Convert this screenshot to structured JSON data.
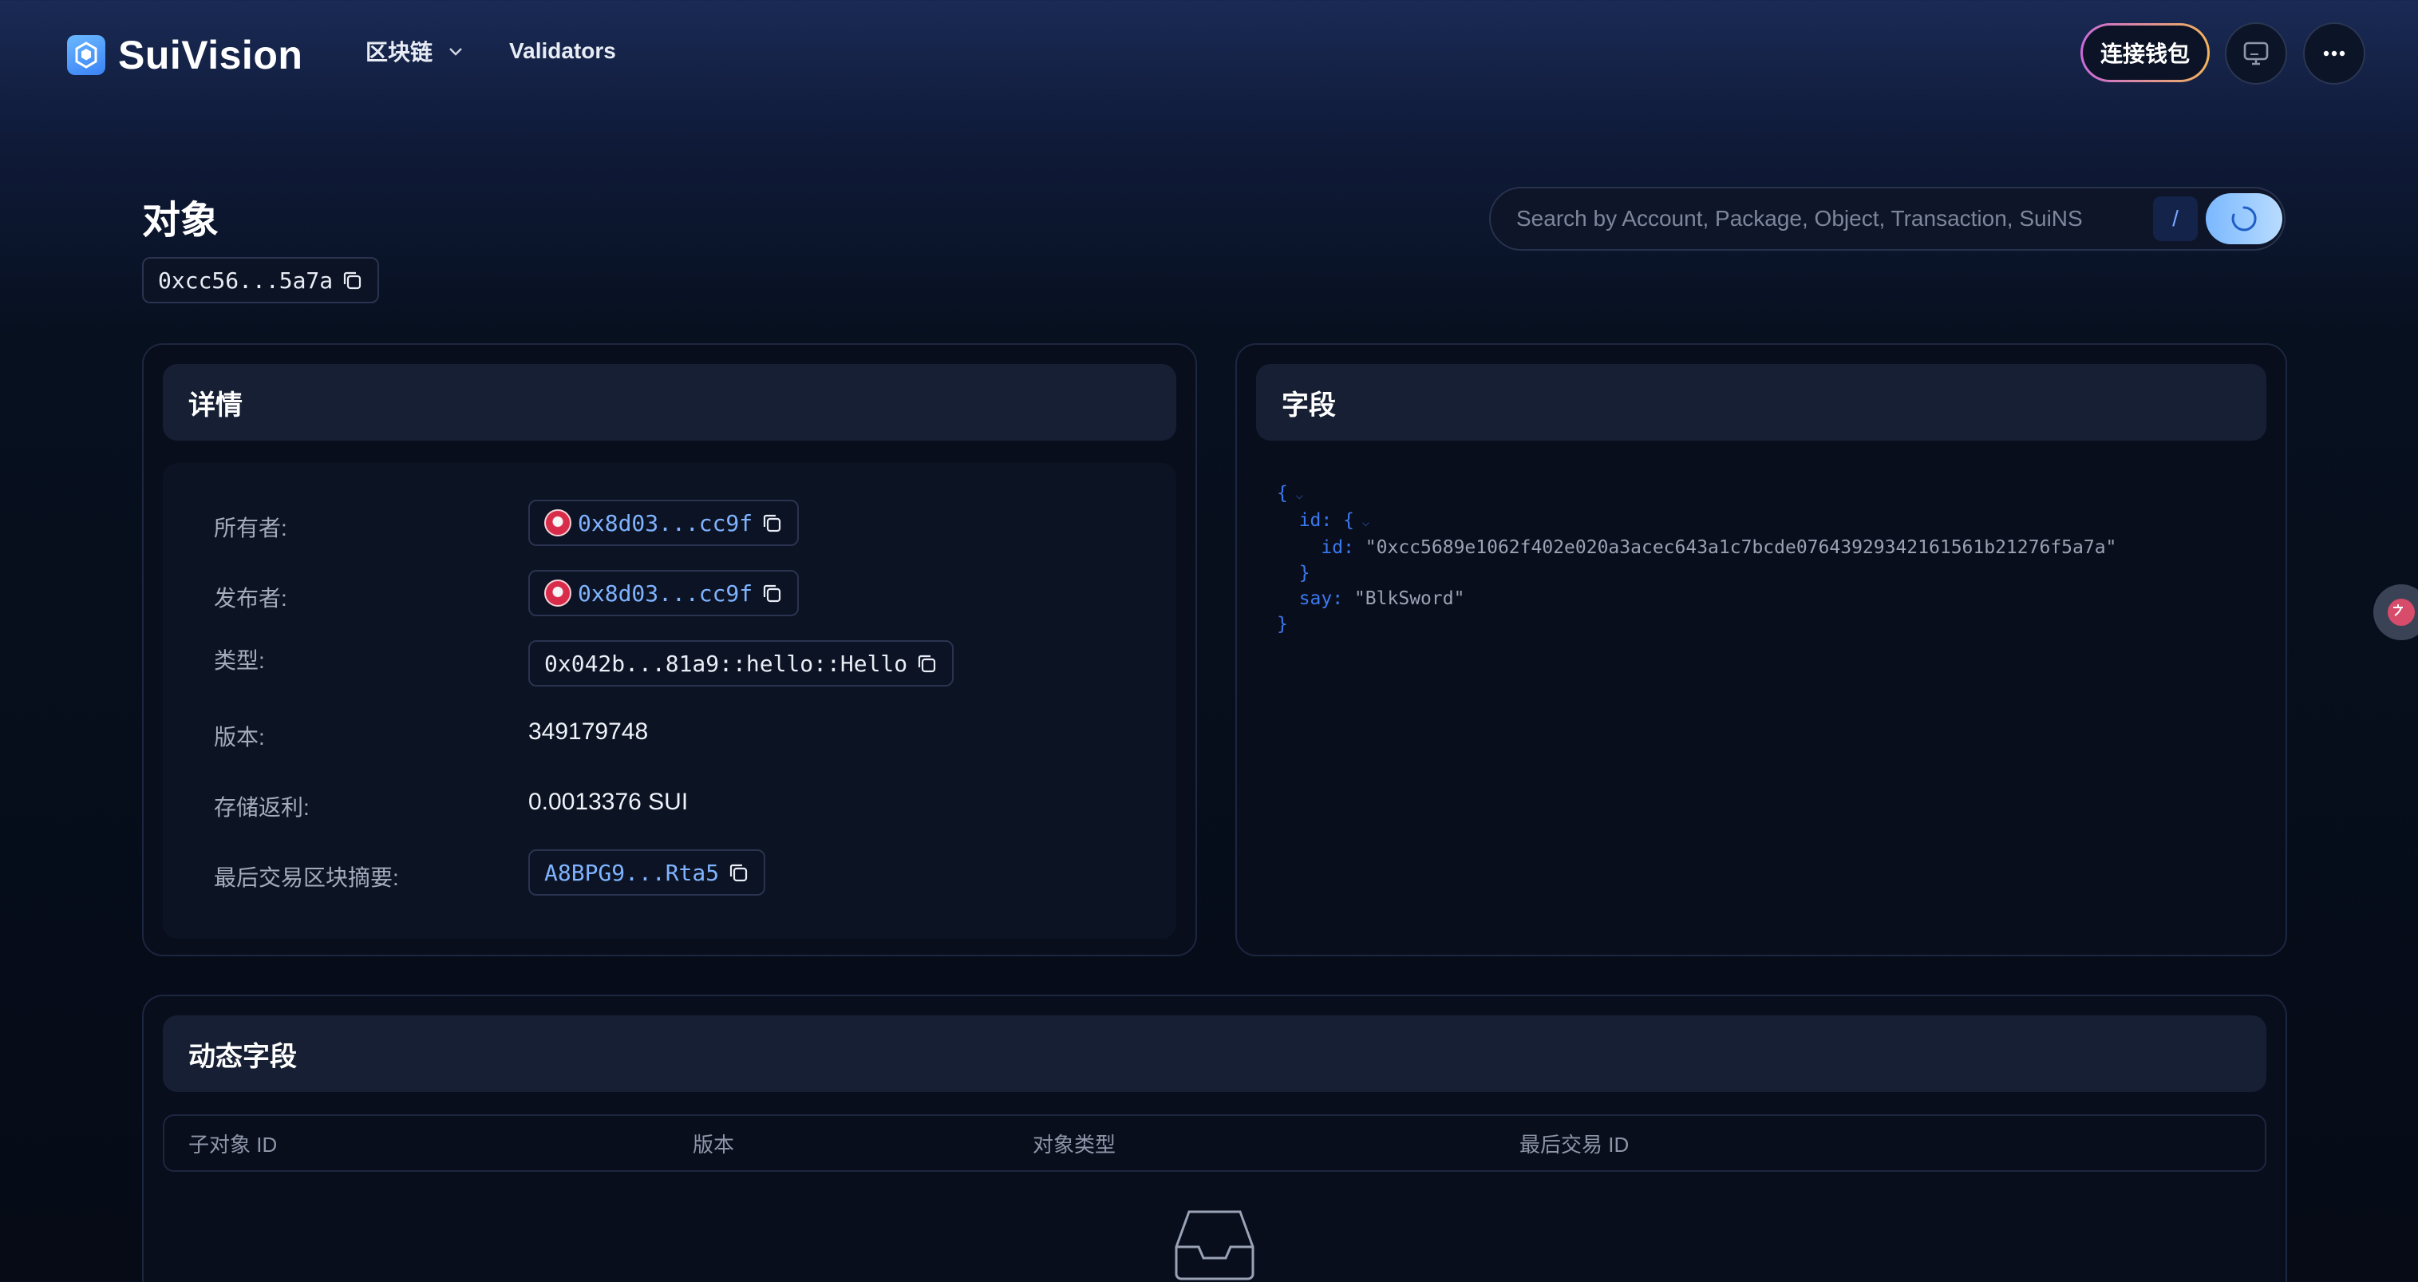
{
  "header": {
    "brand": "SuiVision",
    "nav": [
      {
        "label": "区块链",
        "has_dropdown": true
      },
      {
        "label": "Validators",
        "has_dropdown": false
      }
    ],
    "connect_wallet": "连接钱包",
    "icons": [
      "monitor-icon",
      "more-icon"
    ]
  },
  "page": {
    "title": "对象",
    "object_short_id": "0xcc56...5a7a"
  },
  "search": {
    "placeholder": "Search by Account, Package, Object, Transaction, SuiNS",
    "shortcut": "/"
  },
  "details": {
    "title": "详情",
    "rows": [
      {
        "label": "所有者:",
        "value": "0x8d03...cc9f"
      },
      {
        "label": "发布者:",
        "value": "0x8d03...cc9f"
      },
      {
        "label": "类型:",
        "value": "0x042b...81a9::hello::Hello"
      },
      {
        "label": "版本:",
        "value": "349179748"
      },
      {
        "label": "存储返利:",
        "value": "0.0013376 SUI"
      },
      {
        "label": "最后交易区块摘要:",
        "value": "A8BPG9...Rta5"
      }
    ]
  },
  "fields": {
    "title": "字段",
    "json": {
      "id_key": "id",
      "inner_id_key": "id",
      "inner_id_value": "\"0xcc5689e1062f402e020a3acec643a1c7bcde07643929342161561b21276f5a7a\"",
      "say_key": "say",
      "say_value": "\"BlkSword\""
    }
  },
  "dynamic_fields": {
    "title": "动态字段",
    "columns": [
      "子对象 ID",
      "版本",
      "对象类型",
      "最后交易 ID"
    ]
  },
  "colors": {
    "accent": "#7fb3ff",
    "json_key": "#3c79f0",
    "card_bg": "#080e1c"
  }
}
